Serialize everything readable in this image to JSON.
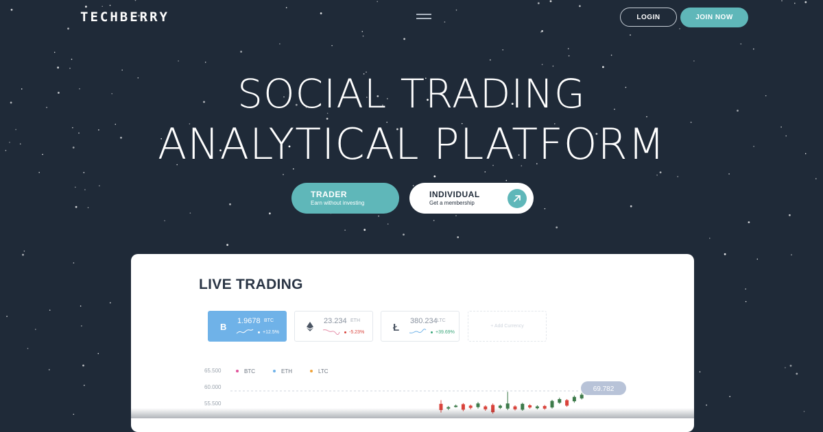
{
  "header": {
    "logo": "TECHBERRY",
    "menu_icon": "hamburger-icon",
    "login_label": "LOGIN",
    "join_label": "JOIN NOW"
  },
  "hero": {
    "line1": "SOCIAL TRADING",
    "line2": "ANALYTICAL PLATFORM"
  },
  "cta": {
    "trader_title": "TRADER",
    "trader_subtitle": "Earn without investing",
    "individual_title": "INDIVIDUAL",
    "individual_subtitle": "Get a membership",
    "individual_icon": "arrow-up-right-icon"
  },
  "live": {
    "title": "LIVE TRADING",
    "currencies": [
      {
        "amount": "1.9678",
        "symbol": "BTC",
        "change": "+12.5%",
        "icon": "bitcoin-icon"
      },
      {
        "amount": "23.234",
        "symbol": "ETH",
        "change": "-5.23%",
        "icon": "ethereum-icon"
      },
      {
        "amount": "380.234",
        "symbol": "LTC",
        "change": "+39.69%",
        "icon": "litecoin-icon"
      }
    ],
    "add_label": "+ Add Currency"
  },
  "colors": {
    "background": "#1f2a38",
    "accent": "#5fb7b9",
    "btc_tile": "#6fb2e8",
    "up": "#3d7a4a",
    "down": "#d9433b"
  },
  "chart_data": {
    "type": "candlestick",
    "y_ticks": [
      "65.500",
      "60.000",
      "55.500"
    ],
    "legend": [
      {
        "name": "BTC",
        "color": "#e0529a"
      },
      {
        "name": "ETH",
        "color": "#6fb2e8"
      },
      {
        "name": "LTC",
        "color": "#f0a33a"
      }
    ],
    "current_value_label": "69.782",
    "candles": [
      {
        "open": 55.9,
        "close": 54.2,
        "high": 56.9,
        "low": 53.5
      },
      {
        "open": 54.6,
        "close": 55.0,
        "high": 55.3,
        "low": 54.2
      },
      {
        "open": 55.1,
        "close": 55.4,
        "high": 55.7,
        "low": 54.9
      },
      {
        "open": 55.8,
        "close": 54.3,
        "high": 56.1,
        "low": 53.9
      },
      {
        "open": 55.4,
        "close": 54.8,
        "high": 55.7,
        "low": 54.4
      },
      {
        "open": 55.0,
        "close": 56.0,
        "high": 56.4,
        "low": 54.6
      },
      {
        "open": 55.2,
        "close": 54.4,
        "high": 55.5,
        "low": 54.0
      },
      {
        "open": 55.6,
        "close": 53.6,
        "high": 56.0,
        "low": 53.2
      },
      {
        "open": 54.8,
        "close": 55.4,
        "high": 55.7,
        "low": 54.5
      },
      {
        "open": 54.6,
        "close": 56.0,
        "high": 59.2,
        "low": 54.2
      },
      {
        "open": 55.2,
        "close": 54.4,
        "high": 55.5,
        "low": 54.1
      },
      {
        "open": 54.3,
        "close": 55.9,
        "high": 56.2,
        "low": 54.0
      },
      {
        "open": 55.5,
        "close": 54.9,
        "high": 55.8,
        "low": 54.6
      },
      {
        "open": 54.7,
        "close": 55.2,
        "high": 55.5,
        "low": 54.4
      },
      {
        "open": 55.3,
        "close": 54.6,
        "high": 55.6,
        "low": 54.3
      },
      {
        "open": 54.9,
        "close": 56.7,
        "high": 57.0,
        "low": 54.6
      },
      {
        "open": 56.2,
        "close": 57.2,
        "high": 57.6,
        "low": 55.9
      },
      {
        "open": 56.9,
        "close": 55.4,
        "high": 57.2,
        "low": 55.1
      },
      {
        "open": 56.6,
        "close": 57.8,
        "high": 58.2,
        "low": 56.2
      },
      {
        "open": 57.4,
        "close": 58.4,
        "high": 58.9,
        "low": 57.1
      }
    ]
  }
}
